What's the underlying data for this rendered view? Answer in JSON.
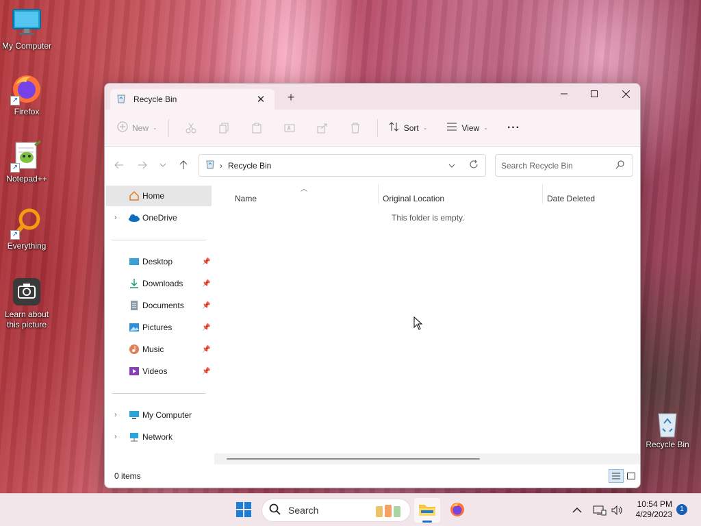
{
  "desktop": {
    "icons": [
      {
        "label": "My Computer"
      },
      {
        "label": "Firefox"
      },
      {
        "label": "Notepad++"
      },
      {
        "label": "Everything"
      },
      {
        "label": "Learn about this picture"
      },
      {
        "label": "Recycle Bin"
      }
    ]
  },
  "window": {
    "tab_title": "Recycle Bin",
    "toolbar": {
      "new_label": "New",
      "sort_label": "Sort",
      "view_label": "View",
      "more_label": "···"
    },
    "address": {
      "crumb": "Recycle Bin",
      "search_placeholder": "Search Recycle Bin"
    },
    "sidebar": {
      "home": "Home",
      "onedrive": "OneDrive",
      "quick": [
        "Desktop",
        "Downloads",
        "Documents",
        "Pictures",
        "Music",
        "Videos"
      ],
      "my_computer": "My Computer",
      "network": "Network"
    },
    "columns": [
      "Name",
      "Original Location",
      "Date Deleted"
    ],
    "empty_message": "This folder is empty.",
    "status": "0 items"
  },
  "taskbar": {
    "search_label": "Search",
    "time": "10:54 PM",
    "date": "4/29/2023",
    "notification_count": "1",
    "accent": "#1a5fb4"
  }
}
